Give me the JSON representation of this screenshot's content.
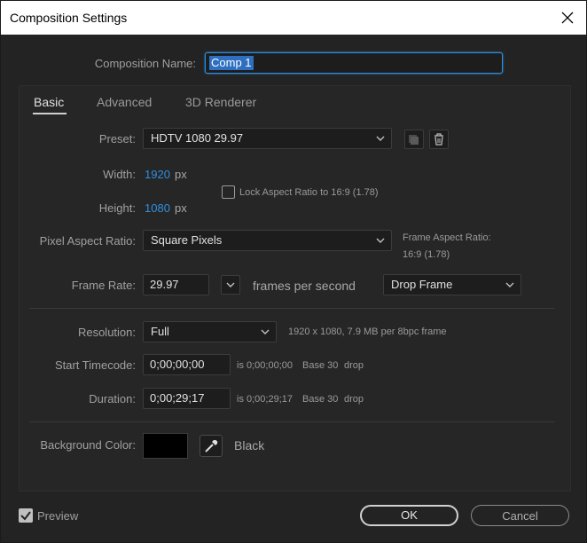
{
  "window": {
    "title": "Composition Settings"
  },
  "comp_name": {
    "label": "Composition Name:",
    "value": "Comp 1"
  },
  "tabs": [
    {
      "label": "Basic"
    },
    {
      "label": "Advanced"
    },
    {
      "label": "3D Renderer"
    }
  ],
  "preset": {
    "label": "Preset:",
    "value": "HDTV 1080 29.97"
  },
  "width": {
    "label": "Width:",
    "value": "1920",
    "unit": "px"
  },
  "height": {
    "label": "Height:",
    "value": "1080",
    "unit": "px"
  },
  "lock_aspect": {
    "label": "Lock Aspect Ratio to 16:9 (1.78)",
    "checked": false
  },
  "pixel_aspect": {
    "label": "Pixel Aspect Ratio:",
    "value": "Square Pixels"
  },
  "frame_aspect": {
    "label": "Frame Aspect Ratio:",
    "value": "16:9 (1.78)"
  },
  "frame_rate": {
    "label": "Frame Rate:",
    "value": "29.97",
    "units": "frames per second",
    "drop": "Drop Frame"
  },
  "resolution": {
    "label": "Resolution:",
    "value": "Full",
    "info": "1920 x 1080, 7.9 MB per 8bpc frame"
  },
  "start_timecode": {
    "label": "Start Timecode:",
    "value": "0;00;00;00",
    "is": "is 0;00;00;00",
    "base": "Base 30",
    "drop": "drop"
  },
  "duration": {
    "label": "Duration:",
    "value": "0;00;29;17",
    "is": "is 0;00;29;17",
    "base": "Base 30",
    "drop": "drop"
  },
  "background": {
    "label": "Background Color:",
    "color": "#000000",
    "name": "Black"
  },
  "footer": {
    "preview_label": "Preview",
    "preview_checked": true,
    "ok_label": "OK",
    "cancel_label": "Cancel"
  },
  "colors": {
    "accent_blue": "#2f8fe0",
    "panel_bg": "#262626",
    "window_bg": "#232323"
  }
}
